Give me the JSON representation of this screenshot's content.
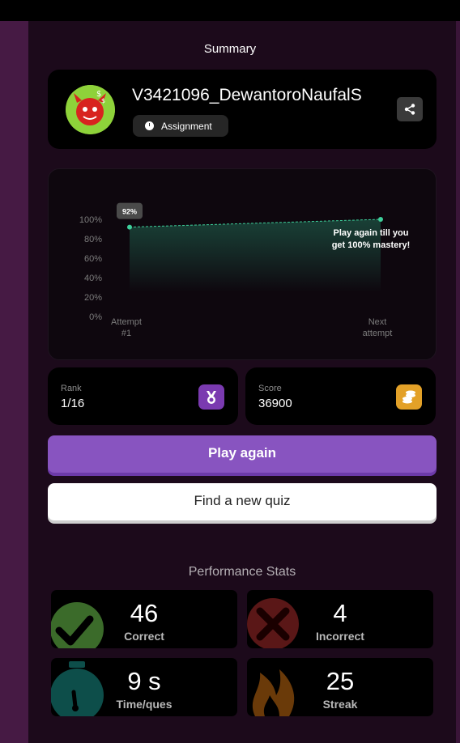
{
  "summary": {
    "title": "Summary"
  },
  "profile": {
    "username": "V3421096_DewantoroNaufalS",
    "tag": "Assignment",
    "avatar_icon": "red-devil-avatar-icon",
    "share_icon": "share-icon"
  },
  "chart_data": {
    "type": "area",
    "categories": [
      "Attempt #1",
      "Next attempt"
    ],
    "x_labels": [
      [
        "Attempt",
        "#1"
      ],
      [
        "Next",
        "attempt"
      ]
    ],
    "y_ticks": [
      "100%",
      "80%",
      "60%",
      "40%",
      "20%",
      "0%"
    ],
    "values": [
      92,
      100
    ],
    "ylim": [
      0,
      100
    ],
    "point_label": "92%",
    "annotation": [
      "Play again till you",
      "get 100% mastery!"
    ],
    "colors": {
      "line": "#3ecf9b",
      "fill_top": "#1b4a3d"
    }
  },
  "rank": {
    "label": "Rank",
    "value": "1/16",
    "color": "#7a3ab0"
  },
  "score": {
    "label": "Score",
    "value": "36900",
    "color": "#e3a128"
  },
  "buttons": {
    "play_again": "Play again",
    "find_quiz": "Find a new quiz"
  },
  "performance": {
    "title": "Performance Stats",
    "stats": [
      {
        "value": "46",
        "label": "Correct",
        "icon": "checkmark-icon",
        "color": "#3b6b2a"
      },
      {
        "value": "4",
        "label": "Incorrect",
        "icon": "cross-icon",
        "color": "#5a1717"
      },
      {
        "value": "9 s",
        "label": "Time/ques",
        "icon": "stopwatch-icon",
        "color": "#0d4e4a"
      },
      {
        "value": "25",
        "label": "Streak",
        "icon": "flame-icon",
        "color": "#6a3a09"
      }
    ]
  }
}
